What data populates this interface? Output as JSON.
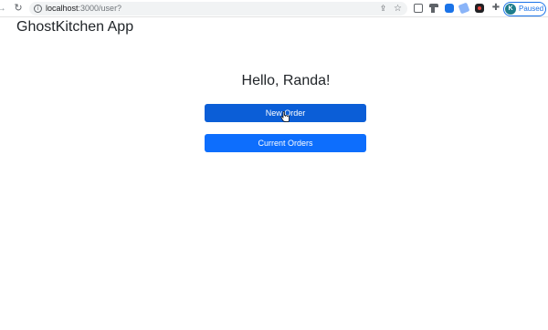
{
  "browser": {
    "url_host": "localhost",
    "url_path": ":3000/user?",
    "profile_initial": "K",
    "profile_status": "Paused"
  },
  "app": {
    "brand": "GhostKitchen App",
    "greeting": "Hello, Randa!",
    "buttons": {
      "new_order": "New Order",
      "current_orders": "Current Orders"
    }
  },
  "colors": {
    "primary": "#0d6efd",
    "primary_hover": "#0b5ed7",
    "profile_accent": "#1a73e8"
  }
}
